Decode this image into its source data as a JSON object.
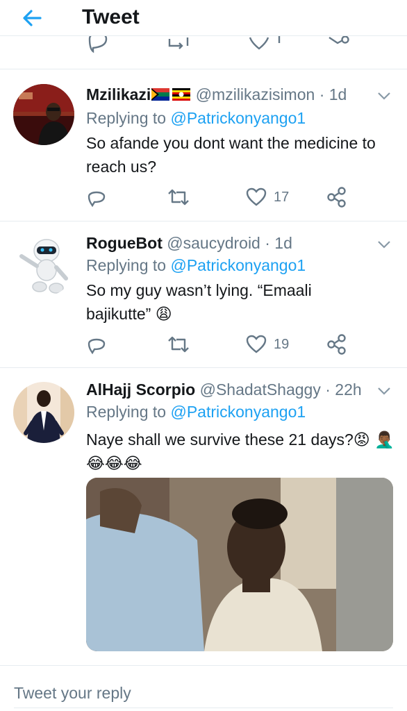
{
  "header": {
    "title": "Tweet"
  },
  "tweets": [
    {
      "name": "Mzilikazi",
      "handle": "@mzilikazisimon",
      "time": "· 1d",
      "replying_prefix": "Replying to ",
      "replying_to": "@Patrickonyango1",
      "body": "So afande you dont want the medicine to reach us?",
      "likes": "17"
    },
    {
      "name": "RogueBot",
      "handle": "@saucydroid",
      "time": "· 1d",
      "replying_prefix": "Replying to ",
      "replying_to": "@Patrickonyango1",
      "body": "So my guy wasn’t lying. “Emaali bajikutte” 😩",
      "likes": "19"
    },
    {
      "name": "AlHajj Scorpio",
      "handle": "@ShadatShaggy",
      "time": "· 22h",
      "replying_prefix": "Replying to ",
      "replying_to": "@Patrickonyango1",
      "body": "Naye shall we survive these 21 days?😡 🤦🏾‍♂️😂😂😂",
      "likes": ""
    }
  ],
  "compose": {
    "placeholder": "Tweet your reply"
  },
  "colors": {
    "accent": "#1da1f2",
    "secondary_text": "#657786",
    "border": "#e6ecf0"
  }
}
